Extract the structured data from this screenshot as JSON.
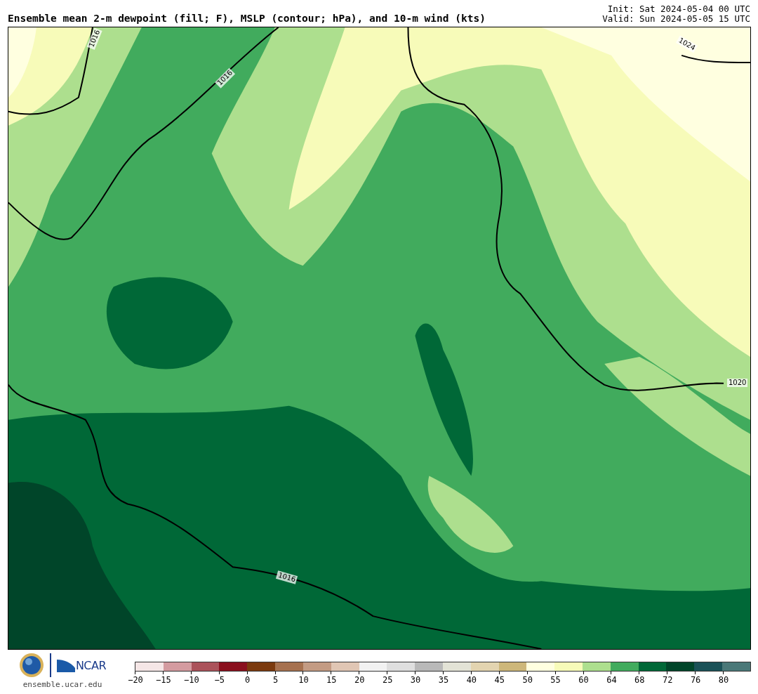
{
  "header": {
    "title": "Ensemble mean 2-m dewpoint (fill; F), MSLP (contour; hPa), and 10-m wind (kts)",
    "init": "Init: Sat 2024-05-04 00 UTC",
    "valid": "Valid: Sun 2024-05-05 15 UTC"
  },
  "map": {
    "contour_labels": [
      "1016",
      "1016",
      "1024",
      "1020",
      "1016"
    ]
  },
  "footer": {
    "logo_text": "NCAR",
    "site": "ensemble.ucar.edu"
  },
  "colorbar": {
    "segments": [
      {
        "tick": "−20",
        "color": "#f5e6e6"
      },
      {
        "tick": "−15",
        "color": "#d49ba0"
      },
      {
        "tick": "−10",
        "color": "#ab525a"
      },
      {
        "tick": "−5",
        "color": "#8a101e"
      },
      {
        "tick": "0",
        "color": "#7b3a0e"
      },
      {
        "tick": "5",
        "color": "#a6714f"
      },
      {
        "tick": "10",
        "color": "#c39b83"
      },
      {
        "tick": "15",
        "color": "#e0c6b4"
      },
      {
        "tick": "20",
        "color": "#f2f2f2"
      },
      {
        "tick": "25",
        "color": "#dfdfdf"
      },
      {
        "tick": "30",
        "color": "#b9b9b9"
      },
      {
        "tick": "35",
        "color": "#e3e3d6"
      },
      {
        "tick": "40",
        "color": "#e3d4b0"
      },
      {
        "tick": "45",
        "color": "#cdb77a"
      },
      {
        "tick": "50",
        "color": "#ffffe0"
      },
      {
        "tick": "55",
        "color": "#f7fbb9"
      },
      {
        "tick": "60",
        "color": "#addf8e"
      },
      {
        "tick": "64",
        "color": "#41ab5d"
      },
      {
        "tick": "68",
        "color": "#006837"
      },
      {
        "tick": "72",
        "color": "#004529"
      },
      {
        "tick": "76",
        "color": "#1a5157"
      },
      {
        "tick": "80",
        "color": "#4a7878"
      }
    ]
  }
}
